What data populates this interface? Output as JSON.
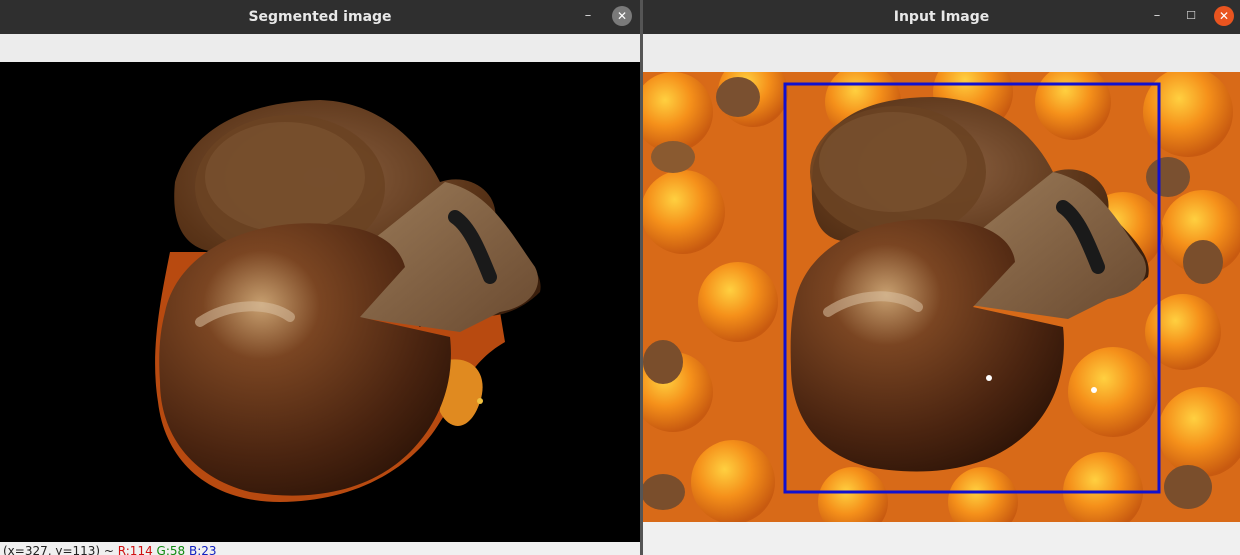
{
  "windows": {
    "segmented": {
      "title": "Segmented image",
      "status": {
        "coords": "(x=327, y=113) ~ ",
        "r": "R:114",
        "g": "G:58",
        "b": "B:23"
      },
      "icons": {
        "minimize": "minimize-icon",
        "close": "close-icon"
      }
    },
    "input": {
      "title": "Input Image",
      "icons": {
        "minimize": "minimize-icon",
        "maximize": "maximize-icon",
        "close": "close-icon"
      }
    }
  },
  "colors": {
    "titlebar": "#2f2f2f",
    "bounding_box": "#1010d0",
    "close_orange": "#e9541f",
    "status_r": "#d01010",
    "status_g": "#108a10",
    "status_b": "#1020c0"
  }
}
